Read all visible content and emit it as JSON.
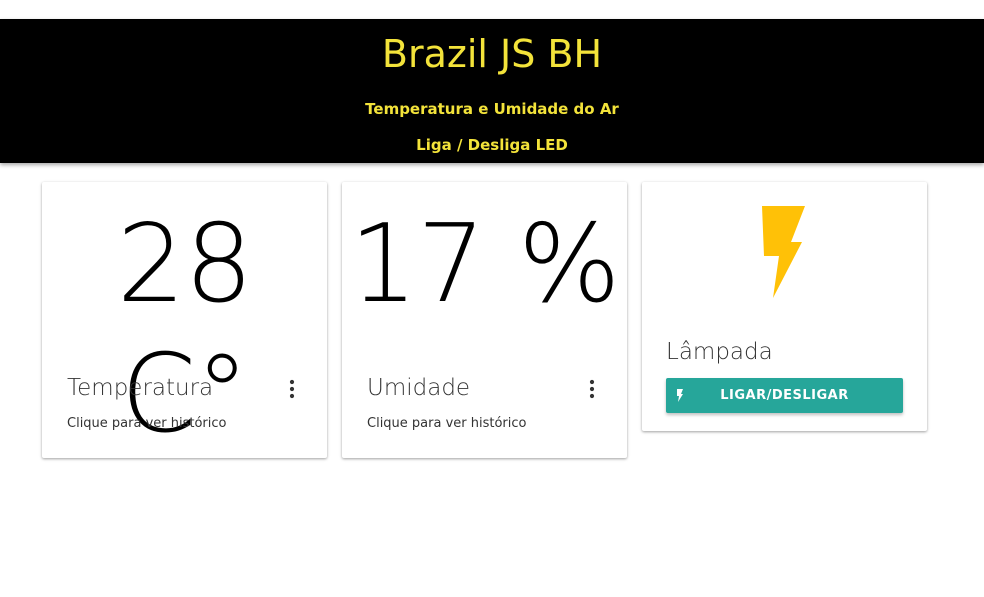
{
  "header": {
    "title": "Brazil JS BH",
    "subtitle_1": "Temperatura e Umidade do Ar",
    "subtitle_2": "Liga / Desliga LED"
  },
  "cards": {
    "temperature": {
      "value": "28 C°",
      "label": "Temperatura",
      "hint": "Clique para ver histórico",
      "menu_icon": "more-vert-icon"
    },
    "humidity": {
      "value": "17 %",
      "label": "Umidade",
      "hint": "Clique para ver histórico",
      "menu_icon": "more-vert-icon"
    },
    "lamp": {
      "icon": "lightning-bolt-icon",
      "label": "Lâmpada",
      "button_label": "LIGAR/DESLIGAR",
      "button_icon": "flash-icon"
    }
  },
  "colors": {
    "header_bg": "#000000",
    "header_text": "#f3e33a",
    "button_bg": "#26a69a",
    "bolt": "#ffc107"
  }
}
